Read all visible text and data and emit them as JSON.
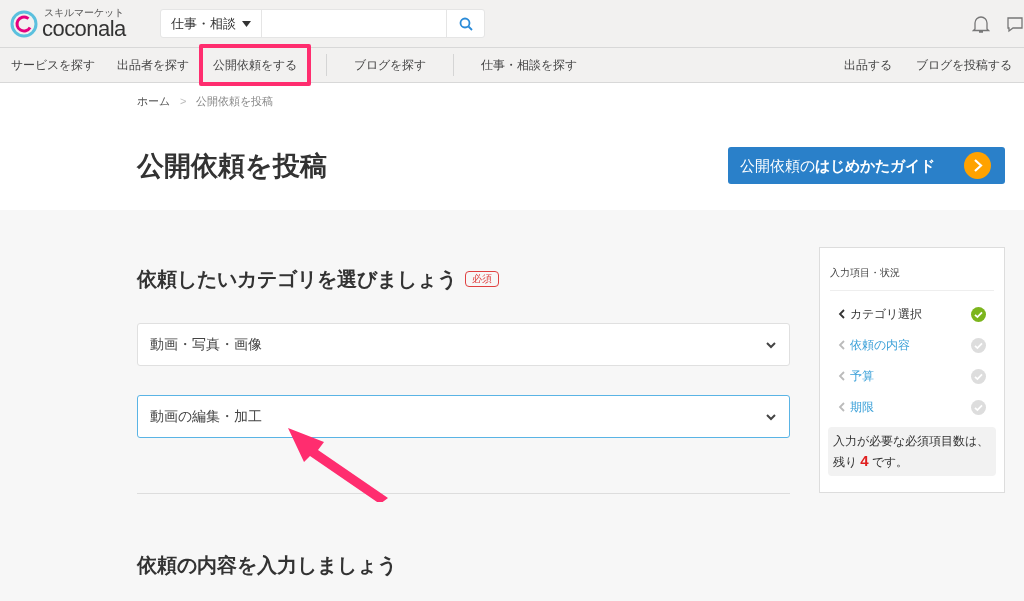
{
  "header": {
    "logo_small": "スキルマーケット",
    "logo": "coconala",
    "search_category": "仕事・相談"
  },
  "nav": {
    "left": [
      {
        "label": "サービスを探す",
        "highlighted": false,
        "divider_after": false
      },
      {
        "label": "出品者を探す",
        "highlighted": false,
        "divider_after": false
      },
      {
        "label": "公開依頼をする",
        "highlighted": true,
        "divider_after": true
      },
      {
        "label": "ブログを探す",
        "highlighted": false,
        "divider_after": true
      },
      {
        "label": "仕事・相談を探す",
        "highlighted": false,
        "divider_after": false
      }
    ],
    "right": [
      "出品する",
      "ブログを投稿する"
    ]
  },
  "breadcrumb": [
    "ホーム",
    "公開依頼を投稿"
  ],
  "breadcrumb_separator": ">",
  "page_title": "公開依頼を投稿",
  "guide_button": {
    "prefix": "公開依頼の",
    "bold": "はじめかたガイド"
  },
  "section1": {
    "heading": "依頼したいカテゴリを選びましょう",
    "badge": "必須",
    "selects": [
      {
        "value": "動画・写真・画像",
        "focused": false
      },
      {
        "value": "動画の編集・加工",
        "focused": true
      }
    ]
  },
  "section2": {
    "heading": "依頼の内容を入力しましょう"
  },
  "status_panel": {
    "title": "入力項目・状況",
    "items": [
      {
        "label": "カテゴリ選択",
        "selected": true,
        "done": true
      },
      {
        "label": "依頼の内容",
        "selected": false,
        "done": false
      },
      {
        "label": "予算",
        "selected": false,
        "done": false
      },
      {
        "label": "期限",
        "selected": false,
        "done": false
      }
    ],
    "remaining_prefix": "入力が必要な必須項目数は、",
    "remaining_pre": "残り",
    "remaining_count": "4",
    "remaining_suffix": "です。"
  },
  "annotation_arrow": true
}
